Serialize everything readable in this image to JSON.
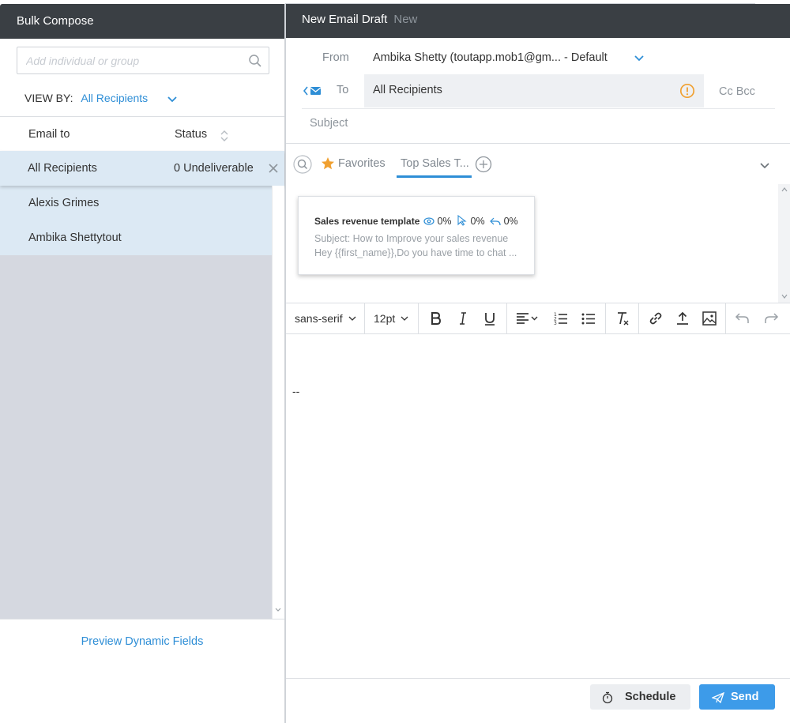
{
  "bulk": {
    "title": "Bulk Compose",
    "search_placeholder": "Add individual or group",
    "view_by_label": "VIEW BY:",
    "view_by_value": "All Recipients",
    "columns": {
      "email_to": "Email to",
      "status": "Status"
    },
    "all_row": {
      "name": "All Recipients",
      "status": "0 Undeliverable"
    },
    "recipients": [
      {
        "name": "Alexis Grimes"
      },
      {
        "name": "Ambika Shettytout"
      }
    ],
    "preview_link": "Preview Dynamic Fields"
  },
  "draft": {
    "title": "New Email Draft",
    "badge": "New",
    "from_label": "From",
    "from_value": "Ambika Shetty (toutapp.mob1@gm... - Default",
    "to_label": "To",
    "to_value": "All Recipients",
    "cc_bcc": "Cc Bcc",
    "subject_placeholder": "Subject"
  },
  "templates": {
    "favorites_label": "Favorites",
    "tab_label": "Top Sales T...",
    "card": {
      "title": "Sales revenue template",
      "open_rate": "0%",
      "click_rate": "0%",
      "reply_rate": "0%",
      "subject_line": "Subject: How to Improve your sales revenue",
      "body_preview": "Hey {{first_name}},Do you have time to chat ..."
    }
  },
  "toolbar": {
    "font_family": "sans-serif",
    "font_size": "12pt"
  },
  "editor": {
    "signature": "--"
  },
  "actions": {
    "schedule_label": "Schedule",
    "send_label": "Send"
  },
  "colors": {
    "header_bg": "#3a3f44",
    "accent": "#2e8ed6",
    "send_button": "#3d9be9",
    "selected_row": "#dce9f4",
    "warning": "#f0a030"
  }
}
